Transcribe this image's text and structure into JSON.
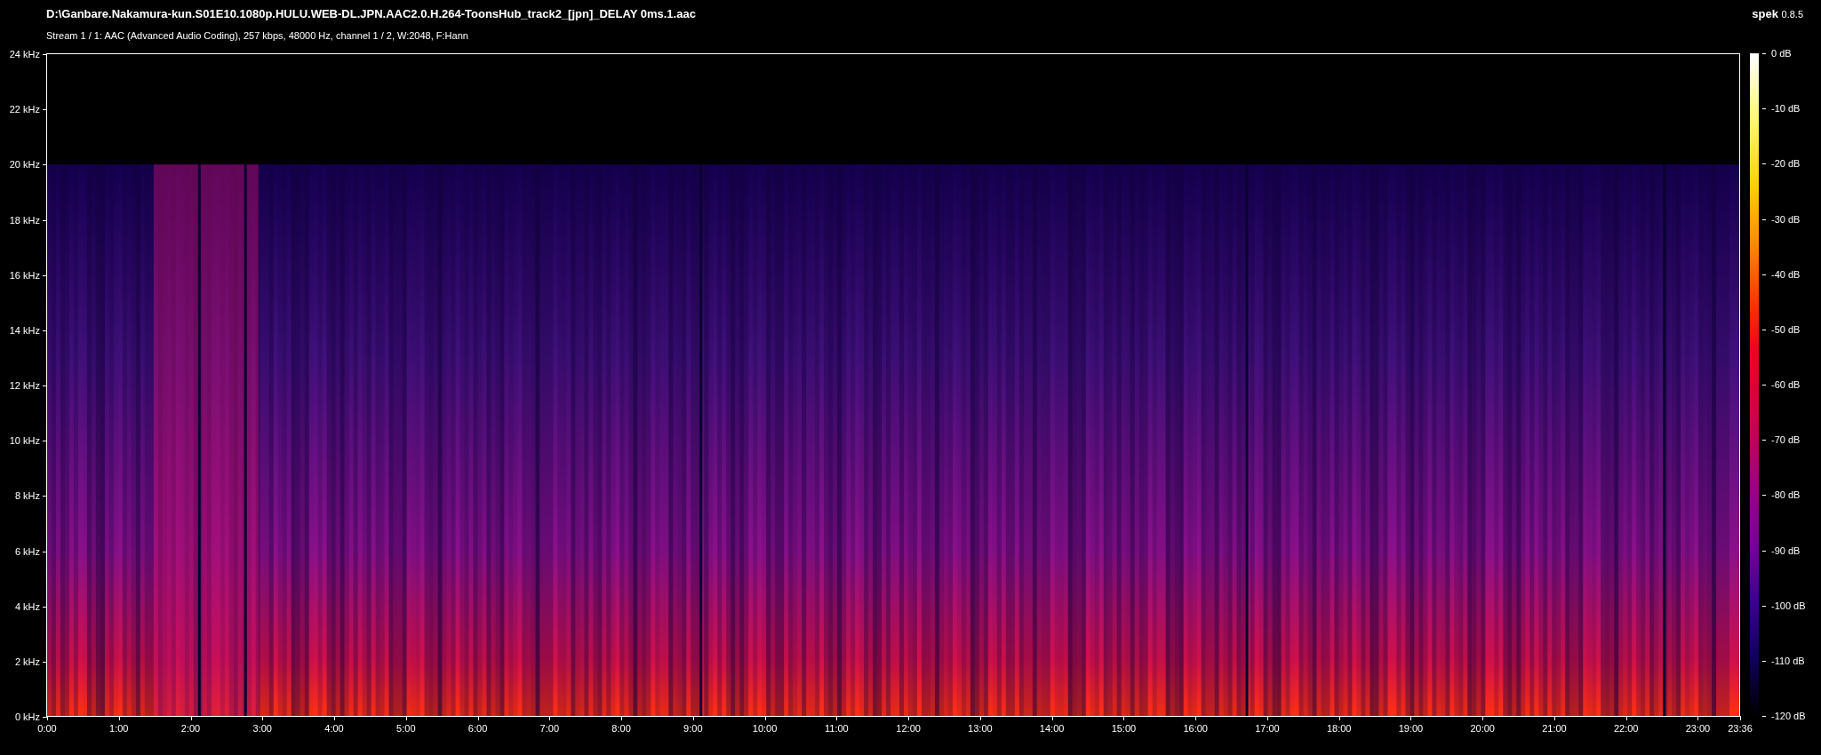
{
  "header": {
    "file_path": "D:\\Ganbare.Nakamura-kun.S01E10.1080p.HULU.WEB-DL.JPN.AAC2.0.H.264-ToonsHub_track2_[jpn]_DELAY 0ms.1.aac",
    "stream_info": "Stream 1 / 1: AAC (Advanced Audio Coding), 257 kbps, 48000 Hz, channel 1 / 2, W:2048, F:Hann"
  },
  "app": {
    "name": "spek",
    "version": "0.8.5"
  },
  "frequency_axis": [
    "24 kHz",
    "22 kHz",
    "20 kHz",
    "18 kHz",
    "16 kHz",
    "14 kHz",
    "12 kHz",
    "10 kHz",
    "8 kHz",
    "6 kHz",
    "4 kHz",
    "2 kHz",
    "0 kHz"
  ],
  "time_axis": [
    "0:00",
    "1:00",
    "2:00",
    "3:00",
    "4:00",
    "5:00",
    "6:00",
    "7:00",
    "8:00",
    "9:00",
    "10:00",
    "11:00",
    "12:00",
    "13:00",
    "14:00",
    "15:00",
    "16:00",
    "17:00",
    "18:00",
    "19:00",
    "20:00",
    "21:00",
    "22:00",
    "23:00",
    "23:36"
  ],
  "color_scale": [
    "0 dB",
    "-10 dB",
    "-20 dB",
    "-30 dB",
    "-40 dB",
    "-50 dB",
    "-60 dB",
    "-70 dB",
    "-80 dB",
    "-90 dB",
    "-100 dB",
    "-110 dB",
    "-120 dB"
  ]
}
